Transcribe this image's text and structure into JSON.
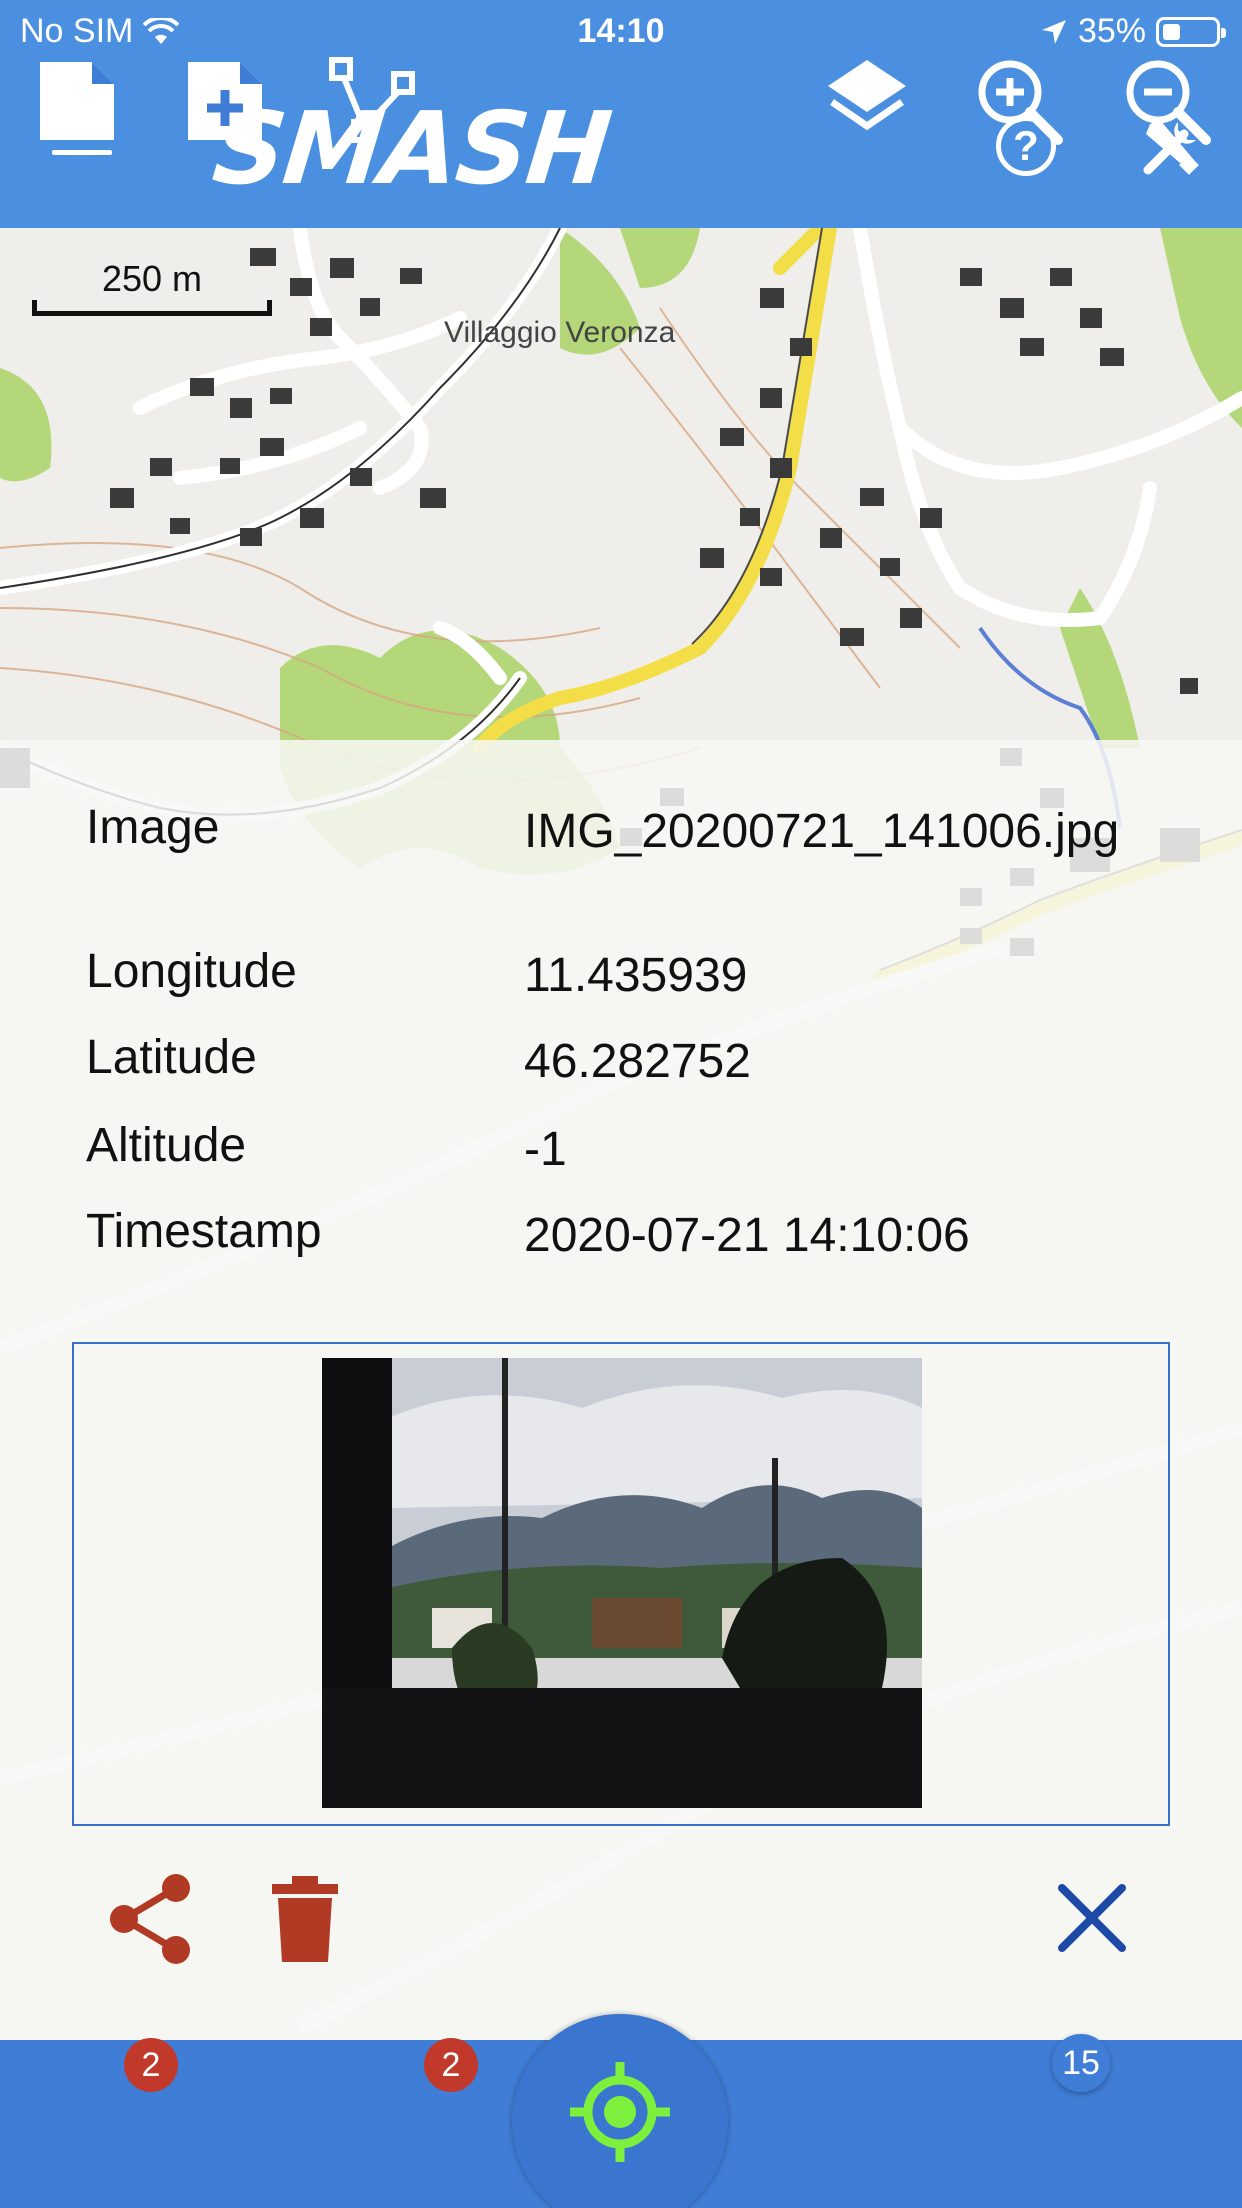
{
  "status_bar": {
    "carrier": "No SIM",
    "time": "14:10",
    "battery": "35%",
    "battery_level": 0.35
  },
  "app_bar": {
    "title": "SMASH",
    "menu_icon": "menu-icon",
    "help_icon": "help-icon",
    "tools_icon": "tools-icon"
  },
  "map": {
    "scale_label": "250 m",
    "place_label": "Villaggio Veronza"
  },
  "info": {
    "rows": [
      {
        "key": "Image",
        "value": "IMG_20200721_141006.jpg"
      },
      {
        "key": "Longitude",
        "value": "11.435939"
      },
      {
        "key": "Latitude",
        "value": "46.282752"
      },
      {
        "key": "Altitude",
        "value": "-1"
      },
      {
        "key": "Timestamp",
        "value": "2020-07-21 14:10:06"
      }
    ]
  },
  "actions": {
    "share_icon": "share-icon",
    "delete_icon": "delete-icon",
    "close_icon": "close-icon"
  },
  "bottom_bar": {
    "notes_badge": "2",
    "gps_log_badge": "2",
    "zoom_level": "15",
    "accent": "#7cf03c"
  }
}
